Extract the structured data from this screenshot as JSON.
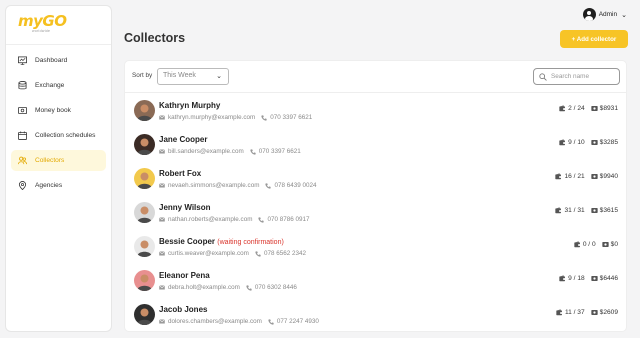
{
  "app": {
    "logo_text": "myGO",
    "logo_sub": "worldwide"
  },
  "sidebar": {
    "items": [
      {
        "label": "Dashboard",
        "icon": "dashboard-icon"
      },
      {
        "label": "Exchange",
        "icon": "exchange-icon"
      },
      {
        "label": "Money book",
        "icon": "money-book-icon"
      },
      {
        "label": "Collection schedules",
        "icon": "calendar-icon"
      },
      {
        "label": "Collectors",
        "icon": "collectors-icon",
        "active": true
      },
      {
        "label": "Agencies",
        "icon": "location-pin-icon"
      }
    ]
  },
  "topbar": {
    "user_label": "Admin"
  },
  "page": {
    "title": "Collectors",
    "add_button": "+  Add collector"
  },
  "toolbar": {
    "sort_label": "Sort by",
    "sort_value": "This Week",
    "search_placeholder": "Search name"
  },
  "colors": {
    "accent": "#f7c426",
    "active_bg": "#fef8dc",
    "status_red": "#d9342b"
  },
  "collectors": [
    {
      "name": "Kathryn Murphy",
      "status": "",
      "email": "kathryn.murphy@example.com",
      "phone": "070 3397 6621",
      "count": "2 / 24",
      "amount": "$8931",
      "avatar_bg": "#8a6a55"
    },
    {
      "name": "Jane Cooper",
      "status": "",
      "email": "bill.sanders@example.com",
      "phone": "070 3397 6621",
      "count": "9 / 10",
      "amount": "$3285",
      "avatar_bg": "#3b2b25"
    },
    {
      "name": "Robert Fox",
      "status": "",
      "email": "nevaeh.simmons@example.com",
      "phone": "078 6439 0024",
      "count": "16 / 21",
      "amount": "$9940",
      "avatar_bg": "#f2c94c"
    },
    {
      "name": "Jenny Wilson",
      "status": "",
      "email": "nathan.roberts@example.com",
      "phone": "070 8786 0917",
      "count": "31 / 31",
      "amount": "$3615",
      "avatar_bg": "#d8d8d8"
    },
    {
      "name": "Bessie Cooper",
      "status": "(waiting confirmation)",
      "email": "curtis.weaver@example.com",
      "phone": "078 6562 2342",
      "count": "0 / 0",
      "amount": "$0",
      "avatar_bg": "#e9e9e9"
    },
    {
      "name": "Eleanor Pena",
      "status": "",
      "email": "debra.holt@example.com",
      "phone": "070 6302 8446",
      "count": "9 / 18",
      "amount": "$6446",
      "avatar_bg": "#e88f8f"
    },
    {
      "name": "Jacob Jones",
      "status": "",
      "email": "dolores.chambers@example.com",
      "phone": "077 2247 4930",
      "count": "11 / 37",
      "amount": "$2609",
      "avatar_bg": "#2f2f2f"
    }
  ]
}
